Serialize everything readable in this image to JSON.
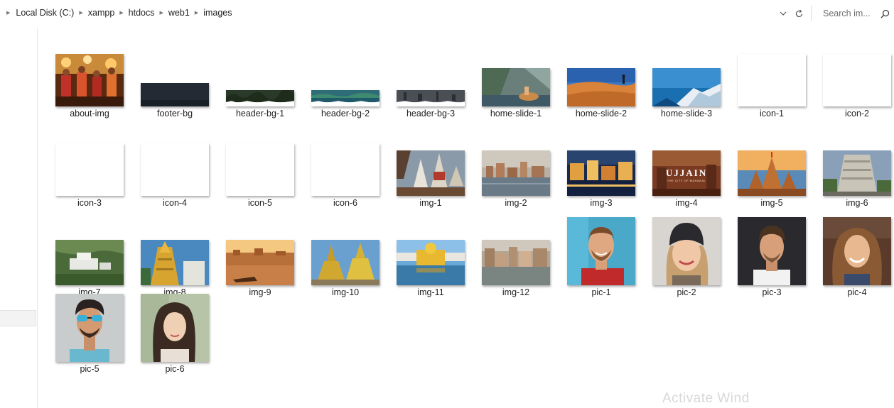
{
  "breadcrumb": [
    "Local Disk (C:)",
    "xampp",
    "htdocs",
    "web1",
    "images"
  ],
  "search": {
    "placeholder": "Search im..."
  },
  "watermark": "Activate Wind",
  "files": [
    {
      "name": "about-img",
      "kind": "about"
    },
    {
      "name": "footer-bg",
      "kind": "footer"
    },
    {
      "name": "header-bg-1",
      "kind": "header1"
    },
    {
      "name": "header-bg-2",
      "kind": "header2"
    },
    {
      "name": "header-bg-3",
      "kind": "header3"
    },
    {
      "name": "home-slide-1",
      "kind": "slide1"
    },
    {
      "name": "home-slide-2",
      "kind": "slide2"
    },
    {
      "name": "home-slide-3",
      "kind": "slide3"
    },
    {
      "name": "icon-1",
      "kind": "blank"
    },
    {
      "name": "icon-2",
      "kind": "blank"
    },
    {
      "name": "icon-3",
      "kind": "blank"
    },
    {
      "name": "icon-4",
      "kind": "blank"
    },
    {
      "name": "icon-5",
      "kind": "blank"
    },
    {
      "name": "icon-6",
      "kind": "blank"
    },
    {
      "name": "img-1",
      "kind": "temple1"
    },
    {
      "name": "img-2",
      "kind": "city2"
    },
    {
      "name": "img-3",
      "kind": "night3"
    },
    {
      "name": "img-4",
      "kind": "ujjain",
      "overlay": "UJJAIN",
      "overlay_sub": "THE CITY OF MAHAKAL"
    },
    {
      "name": "img-5",
      "kind": "temple5"
    },
    {
      "name": "img-6",
      "kind": "temple6"
    },
    {
      "name": "img-7",
      "kind": "hill7"
    },
    {
      "name": "img-8",
      "kind": "temple8"
    },
    {
      "name": "img-9",
      "kind": "ghat9"
    },
    {
      "name": "img-10",
      "kind": "temple10"
    },
    {
      "name": "img-11",
      "kind": "golden11"
    },
    {
      "name": "img-12",
      "kind": "city12"
    },
    {
      "name": "pic-1",
      "kind": "man1"
    },
    {
      "name": "pic-2",
      "kind": "woman2"
    },
    {
      "name": "pic-3",
      "kind": "man3"
    },
    {
      "name": "pic-4",
      "kind": "woman4"
    },
    {
      "name": "pic-5",
      "kind": "man5"
    },
    {
      "name": "pic-6",
      "kind": "woman6"
    }
  ]
}
